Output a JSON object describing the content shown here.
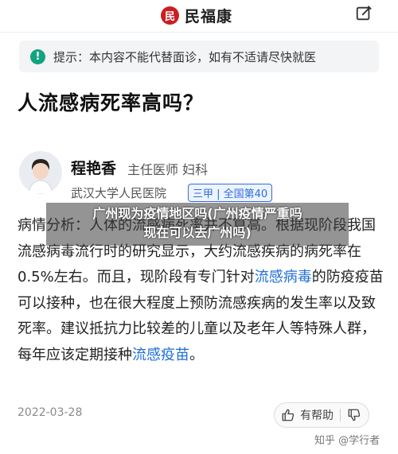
{
  "header": {
    "brand_logo_char": "民",
    "brand_name": "民福康"
  },
  "notice": {
    "icon_char": "!",
    "text": "提示：本内容不能代替面诊，如有不适请尽快就医"
  },
  "question": "人流感病死率高吗？",
  "doctor": {
    "name": "程艳香",
    "title": "主任医师  妇科",
    "hospital": "武汉大学人民医院",
    "badge": "三甲 | 全国第40"
  },
  "answer": {
    "part1": "病情分析：人体的流感病死率并不算高。根据现阶段我国流感病毒流行时的研究显示，大约流感疾病的病死率在0.5%左右。而且，现阶段有专门针对",
    "link1": "流感病毒",
    "part2": "的防疫疫苗可以接种，也在很大程度上预防流感疾病的发生率以及致死率。建议抵抗力比较差的儿童以及老年人等特殊人群，每年应该定期接种",
    "link2": "流感疫苗",
    "part3": "。"
  },
  "watermark": {
    "line1": "广州现为疫情地区吗(广州疫情严重吗",
    "line2": "现在可以去广州吗)"
  },
  "footer": {
    "date": "2022-03-28",
    "helpful_label": "有帮助",
    "source": "知乎 @学行者"
  },
  "colors": {
    "brand_red": "#c81f23",
    "notice_green": "#13a37f",
    "link_blue": "#1f6fd6"
  }
}
